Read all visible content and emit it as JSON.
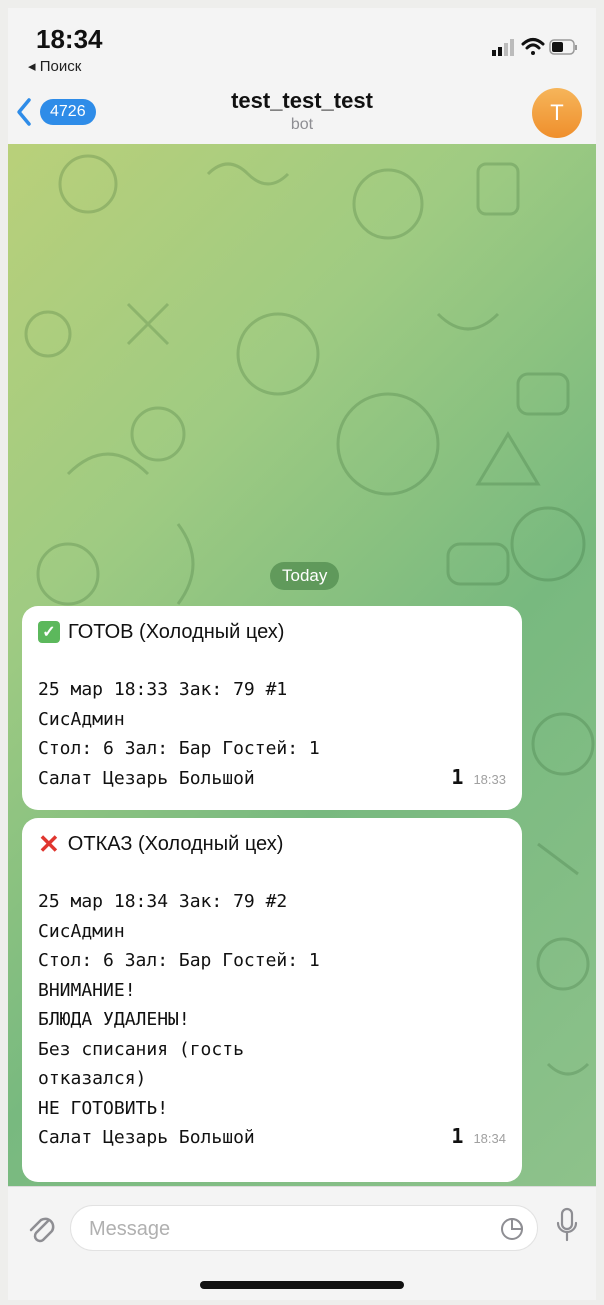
{
  "status_bar": {
    "time": "18:34",
    "back_app": "◂ Поиск"
  },
  "header": {
    "back_count": "4726",
    "title": "test_test_test",
    "subtitle": "bot",
    "avatar_letter": "T"
  },
  "chat": {
    "date_label": "Today",
    "messages": [
      {
        "status": "ready",
        "headline": "ГОТОВ (Холодный цех)",
        "lines": [
          "25 мар 18:33 Зак: 79 #1",
          "СисАдмин",
          "Стол: 6 Зал: Бар Гостей: 1"
        ],
        "item": "Салат Цезарь Большой",
        "qty": "1",
        "time": "18:33"
      },
      {
        "status": "refused",
        "headline": "ОТКАЗ (Холодный цех)",
        "lines": [
          "25 мар 18:34 Зак: 79 #2",
          "СисАдмин",
          "Стол: 6 Зал: Бар Гостей: 1",
          "ВНИМАНИЕ!",
          "БЛЮДА УДАЛЕНЫ!",
          "Без списания (гость",
          "отказался)",
          "НЕ ГОТОВИТЬ!"
        ],
        "item": "Салат Цезарь Большой",
        "qty": "1",
        "time": "18:34"
      }
    ]
  },
  "input": {
    "placeholder": "Message"
  },
  "colors": {
    "accent": "#2e8ce8",
    "avatar": "#f0a040",
    "check": "#5cb85c",
    "cross": "#e0362f"
  },
  "icons": [
    "back-chevron-icon",
    "signal-icon",
    "wifi-icon",
    "battery-icon",
    "attach-icon",
    "sticker-icon",
    "mic-icon"
  ]
}
